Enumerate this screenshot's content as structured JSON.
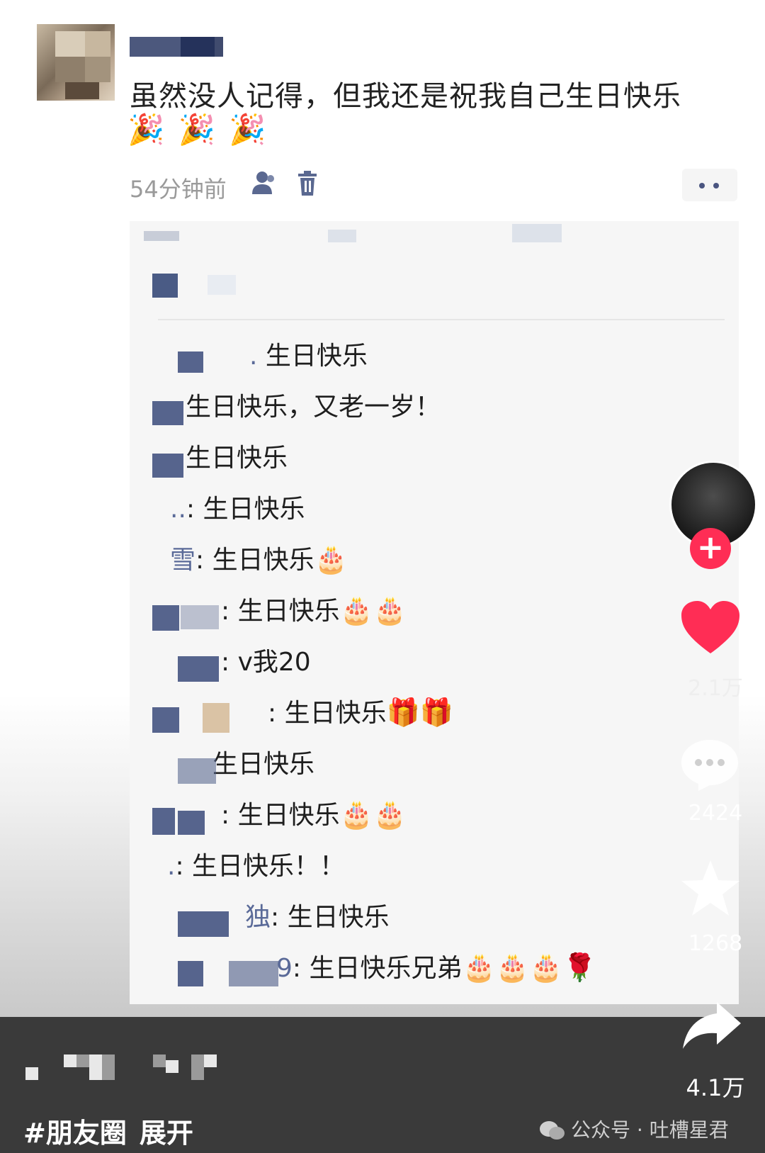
{
  "post": {
    "text": "虽然没人记得，但我还是祝我自己生日快乐",
    "party_emojis": [
      "🎉",
      "🎉",
      "🎉"
    ],
    "time": "54分钟前"
  },
  "comments": [
    {
      "name": ".",
      "sep": "",
      "text": " 生日快乐",
      "emoji": ""
    },
    {
      "name": "",
      "sep": "",
      "text": "生日快乐，又老一岁！",
      "emoji": ""
    },
    {
      "name": "",
      "sep": "",
      "text": "生日快乐",
      "emoji": ""
    },
    {
      "name": "..",
      "sep": ": ",
      "text": "生日快乐",
      "emoji": ""
    },
    {
      "name": "雪",
      "sep": ": ",
      "text": "生日快乐",
      "emoji": "🎂"
    },
    {
      "name": "",
      "sep": ": ",
      "text": "生日快乐",
      "emoji": "🎂🎂"
    },
    {
      "name": "",
      "sep": ": ",
      "text": "v我20",
      "emoji": ""
    },
    {
      "name": "",
      "sep": ": ",
      "text": "生日快乐",
      "emoji": "🎁🎁"
    },
    {
      "name": "",
      "sep": "",
      "text": "生日快乐",
      "emoji": ""
    },
    {
      "name": "",
      "sep": ": ",
      "text": "生日快乐",
      "emoji": "🎂🎂"
    },
    {
      "name": ".",
      "sep": ": ",
      "text": "生日快乐！！",
      "emoji": ""
    },
    {
      "name": "独",
      "sep": ": ",
      "text": "生日快乐",
      "emoji": ""
    },
    {
      "name": "9",
      "sep": ": ",
      "text": "生日快乐兄弟",
      "emoji": "🎂🎂🎂🌹"
    }
  ],
  "sidebar": {
    "likes": "2.1万",
    "comments": "2424",
    "favorites": "1268",
    "shares": "4.1万"
  },
  "footer": {
    "hashtag": "#朋友圈",
    "expand": "展开",
    "watermark": "公众号 · 吐槽星君"
  },
  "colors": {
    "like_red": "#ff2d55",
    "name_blue": "#5a6a98",
    "bottom_bar": "#3a3a3a"
  },
  "icons": [
    "contact-icon",
    "trash-icon",
    "more-icon",
    "heart-icon",
    "comment-icon",
    "star-icon",
    "share-icon",
    "wechat-icon"
  ]
}
